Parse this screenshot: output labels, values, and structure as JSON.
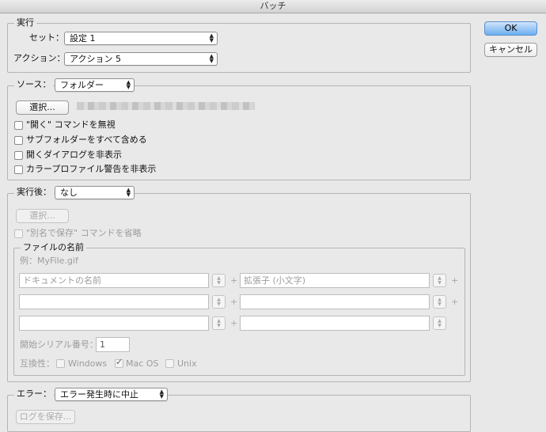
{
  "window": {
    "title": "バッチ"
  },
  "buttons": {
    "ok": "OK",
    "cancel": "キャンセル"
  },
  "play": {
    "legend": "実行",
    "set_label": "セット：",
    "set_value": "設定 1",
    "action_label": "アクション：",
    "action_value": "アクション 5"
  },
  "source": {
    "label": "ソース：",
    "value": "フォルダー",
    "choose": "選択...",
    "options": [
      "\"開く\" コマンドを無視",
      "サブフォルダーをすべて含める",
      "開くダイアログを非表示",
      "カラープロファイル警告を非表示"
    ]
  },
  "destination": {
    "label": "実行後：",
    "value": "なし",
    "choose": "選択...",
    "override_save": "\"別名で保存\" コマンドを省略"
  },
  "file_naming": {
    "legend": "ファイルの名前",
    "example": "例：MyFile.gif",
    "rows": [
      {
        "left": "ドキュメントの名前",
        "right": "拡張子 (小文字)"
      },
      {
        "left": "",
        "right": ""
      },
      {
        "left": "",
        "right": ""
      }
    ],
    "serial_label": "開始シリアル番号：",
    "serial_value": "1",
    "compat_label": "互換性：",
    "compat": [
      {
        "label": "Windows",
        "checked": false
      },
      {
        "label": "Mac OS",
        "checked": true
      },
      {
        "label": "Unix",
        "checked": false
      }
    ]
  },
  "errors": {
    "label": "エラー：",
    "value": "エラー発生時に中止",
    "save_log": "ログを保存..."
  }
}
